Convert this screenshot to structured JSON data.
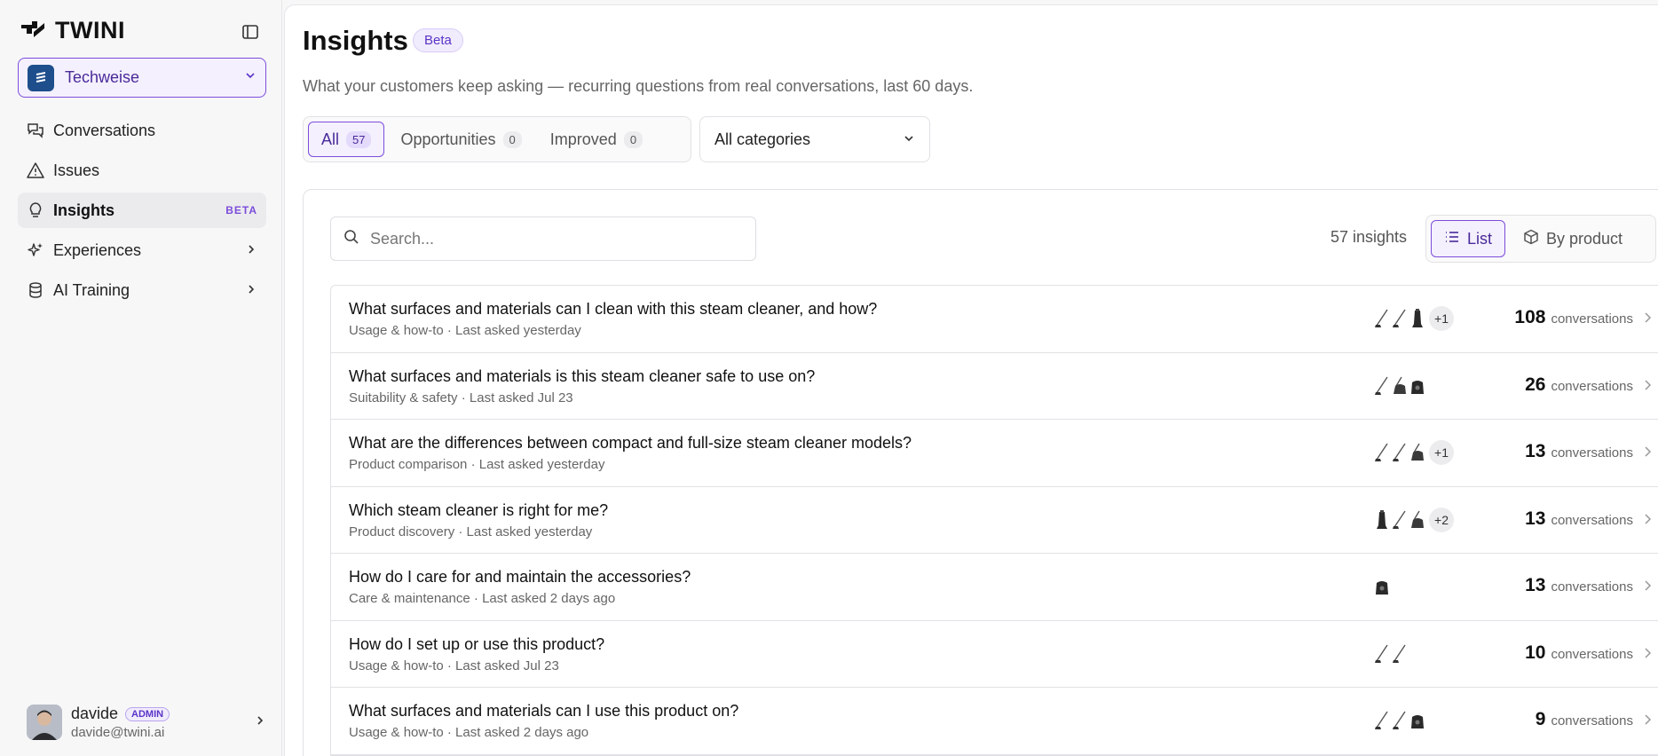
{
  "brand": {
    "name": "TWINI"
  },
  "workspace": {
    "name": "Techweise"
  },
  "nav": {
    "items": [
      {
        "label": "Conversations",
        "icon": "chat-bubbles-icon"
      },
      {
        "label": "Issues",
        "icon": "warning-triangle-icon"
      },
      {
        "label": "Insights",
        "icon": "lightbulb-icon",
        "badge": "BETA",
        "active": true
      },
      {
        "label": "Experiences",
        "icon": "sparkles-icon"
      },
      {
        "label": "AI Training",
        "icon": "database-icon"
      }
    ]
  },
  "user": {
    "name": "davide",
    "role": "ADMIN",
    "email": "davide@twini.ai"
  },
  "header": {
    "title": "Insights",
    "badge": "Beta",
    "subtitle": "What your customers keep asking — recurring questions from real conversations, last 60 days."
  },
  "filters": {
    "tabs": [
      {
        "label": "All",
        "count": "57",
        "active": true
      },
      {
        "label": "Opportunities",
        "count": "0"
      },
      {
        "label": "Improved",
        "count": "0"
      }
    ],
    "category": "All categories"
  },
  "toolbar": {
    "search_placeholder": "Search...",
    "count_label": "57 insights",
    "view_list": "List",
    "view_by_product": "By product"
  },
  "insights": [
    {
      "question": "What surfaces and materials can I clean with this steam cleaner, and how?",
      "meta": "Usage & how-to · Last asked yesterday",
      "thumbs": [
        "wand",
        "wand",
        "tower"
      ],
      "more": "+1",
      "count": "108",
      "unit": "conversations"
    },
    {
      "question": "What surfaces and materials is this steam cleaner safe to use on?",
      "meta": "Suitability & safety · Last asked Jul 23",
      "thumbs": [
        "wand",
        "canister",
        "unit"
      ],
      "more": "",
      "count": "26",
      "unit": "conversations"
    },
    {
      "question": "What are the differences between compact and full-size steam cleaner models?",
      "meta": "Product comparison · Last asked yesterday",
      "thumbs": [
        "wand",
        "wand",
        "canister"
      ],
      "more": "+1",
      "count": "13",
      "unit": "conversations"
    },
    {
      "question": "Which steam cleaner is right for me?",
      "meta": "Product discovery · Last asked yesterday",
      "thumbs": [
        "tower",
        "wand",
        "canister"
      ],
      "more": "+2",
      "count": "13",
      "unit": "conversations"
    },
    {
      "question": "How do I care for and maintain the accessories?",
      "meta": "Care & maintenance · Last asked 2 days ago",
      "thumbs": [
        "unit"
      ],
      "more": "",
      "count": "13",
      "unit": "conversations"
    },
    {
      "question": "How do I set up or use this product?",
      "meta": "Usage & how-to · Last asked Jul 23",
      "thumbs": [
        "wand",
        "wand"
      ],
      "more": "",
      "count": "10",
      "unit": "conversations"
    },
    {
      "question": "What surfaces and materials can I use this product on?",
      "meta": "Usage & how-to · Last asked 2 days ago",
      "thumbs": [
        "wand",
        "wand",
        "unit"
      ],
      "more": "",
      "count": "9",
      "unit": "conversations"
    }
  ],
  "colors": {
    "accent": "#7c4ddb",
    "accent_bg": "#f4f0fd",
    "workspace_avatar": "#1e4e8c"
  }
}
